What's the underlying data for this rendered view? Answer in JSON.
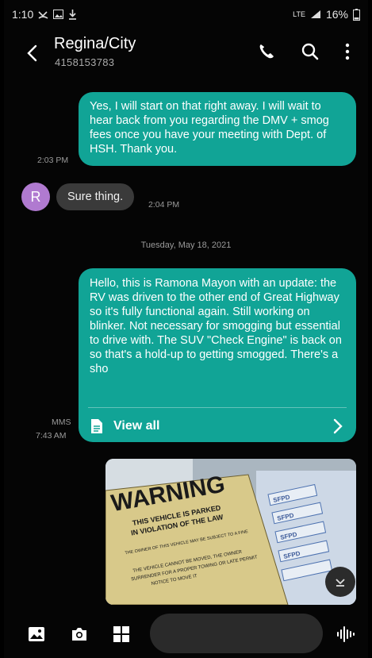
{
  "status_bar": {
    "time": "1:10",
    "network": "LTE",
    "battery": "16%"
  },
  "header": {
    "contact_name": "Regina/City",
    "contact_number": "4158153783"
  },
  "messages": [
    {
      "direction": "outgoing",
      "text": "Yes, I will start on that right away.  I will wait to hear back from you regarding the DMV + smog fees once you have your meeting with Dept. of HSH.  Thank you.",
      "time": "2:03 PM"
    },
    {
      "direction": "incoming",
      "avatar_letter": "R",
      "text": "Sure thing.",
      "time": "2:04 PM"
    },
    {
      "direction": "date",
      "text": "Tuesday, May 18, 2021"
    },
    {
      "direction": "outgoing",
      "type_label": "MMS",
      "text": "Hello, this is Ramona Mayon with an update: the RV was driven to the other end of Great Highway so it's fully functional again.  Still working on blinker. Not necessary for smogging but essential to drive with.  The SUV \"Check Engine\" is back on so that's a hold-up to getting smogged.  There's a sho",
      "view_all_label": "View all",
      "time": "7:43 AM"
    }
  ],
  "photo": {
    "sign_heading": "WARNING",
    "sign_line1": "THIS VEHICLE IS PARKED",
    "sign_line2": "IN VIOLATION OF THE LAW",
    "sign_line3": "THE OWNER OF THIS VEHICLE MAY BE SUBJECT TO A FINE",
    "sign_line4": "THE VEHICLE CANNOT BE MOVED, THE OWNER",
    "sign_line5": "SURRENDER FOR A PROPER TOWING OR LATE PERMIT",
    "sign_line6": "NOTICE TO MOVE IT",
    "ticket_label": "SFPD"
  },
  "colors": {
    "accent": "#11a496",
    "incoming_bubble": "#3a3a3a",
    "avatar": "#b07ad0",
    "background": "#050505"
  }
}
